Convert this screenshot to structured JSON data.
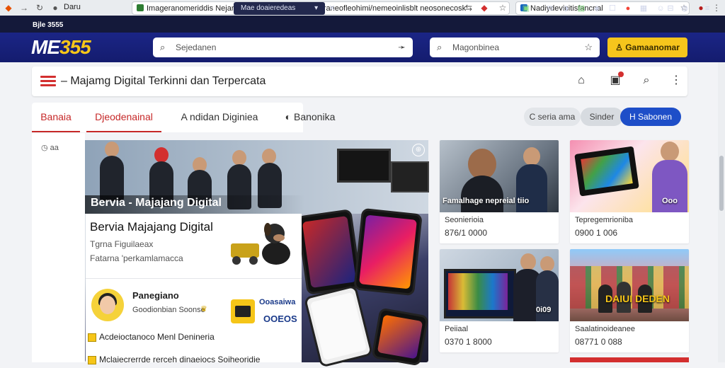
{
  "browser": {
    "back_icon": "back-arrow-icon",
    "tab_label": "Daru",
    "address": "Imageranomeriddis Nejaris Teonditfgaerteuan/ueperaneofleohimi/nemeoinlisblt neosonecosk",
    "second_tab": "Nadiydevicitisfancnal",
    "ext_strip_tab": "Mae doaieredeas"
  },
  "header": {
    "logo_main": "ME",
    "logo_accent": "355",
    "logo_badge": "Bjle 3555",
    "search_placeholder": "Sejedanen",
    "search2_placeholder": "Magonbinea",
    "login_label": "Gamaanomar"
  },
  "titlebar": {
    "title": "– Majamg Digital Terkinni dan Terpercata"
  },
  "nav": {
    "tabs": [
      "Banaia",
      "Djeodenainal",
      "A ndidan Diginiea",
      "Banonika"
    ],
    "pills": [
      "C seria ama",
      "Sinder",
      "H Sabonen"
    ]
  },
  "sidebar": {
    "item": "◷ aa"
  },
  "hero": {
    "caption": "Bervia - Majajang Digital"
  },
  "info": {
    "title": "Bervia Majajang Digital",
    "sub1": "Tgrna Figuilaeax",
    "sub2": "Fatarna 'perkamlamacca",
    "user_name": "Panegiano",
    "user_sub": "Goodionbian Soonse",
    "wallet_label": "Ooasaiwa",
    "wallet_value": "OOEOS",
    "check1": "Acdeioctanoco Menl Denineria",
    "check2": "Mclaiecrerrde rerceh dinaeiocs Soiheoridie"
  },
  "cards": [
    {
      "caption": "Famalhage nepreial tiio",
      "title": "Seonierioia",
      "value": "876/1 0000"
    },
    {
      "caption": "Ooo",
      "title": "Tepregemrioniba",
      "value": "0900 1 006"
    },
    {
      "caption": "0i09",
      "title": "Peiiaal",
      "value": "0370 1 8000"
    },
    {
      "caption": "DAIUI DEDEN",
      "title": "Saalatinoideanee",
      "value": "08771 0 088"
    }
  ],
  "colors": {
    "header_bg": "#1b2586",
    "accent_red": "#c62828",
    "cta_yellow": "#f6c51c",
    "pill_blue": "#1e4ec8"
  }
}
